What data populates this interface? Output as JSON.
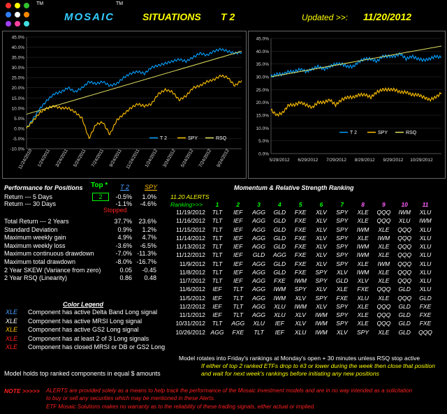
{
  "header": {
    "tm1": "TM",
    "title1": "MOSAIC",
    "tm2": "TM",
    "title2": "SITUATIONS",
    "title3": "T 2",
    "updated_label": "Updated >>:",
    "updated_date": "11/20/2012"
  },
  "colors": {
    "t2": "#00a0ff",
    "spy": "#ffc000",
    "trend": "#e0e060",
    "yellow": "#ffff00",
    "green": "#00ff00",
    "blue": "#4aa0ff",
    "red": "#ff2020",
    "orange": "#ffc000",
    "cyan_title": "#33ccff"
  },
  "chart_data": [
    {
      "type": "line",
      "ylim": [
        -0.1,
        0.45
      ],
      "yticks": [
        "45.0%",
        "40.0%",
        "35.0%",
        "30.0%",
        "25.0%",
        "20.0%",
        "15.0%",
        "10.0%",
        "5.0%",
        "0.0%",
        "-5.0%",
        "-10.0%"
      ],
      "xticks": [
        "11/24/2010",
        "1/24/2011",
        "3/24/2011",
        "5/24/2011",
        "7/24/2011",
        "9/24/2011",
        "11/24/2011",
        "1/24/2012",
        "3/24/2012",
        "5/24/2012",
        "7/24/2012",
        "9/24/2012"
      ],
      "legend": [
        "T 2",
        "SPY",
        "RSQ"
      ],
      "series": [
        {
          "name": "T 2",
          "values": [
            0.0,
            0.05,
            0.1,
            0.14,
            0.17,
            0.18,
            0.2,
            0.18,
            0.2,
            0.23,
            0.22,
            0.23,
            0.21,
            0.22,
            0.25,
            0.27,
            0.28,
            0.27,
            0.3,
            0.31,
            0.32,
            0.33,
            0.34,
            0.33,
            0.35,
            0.37,
            0.36,
            0.38,
            0.39,
            0.38,
            0.37,
            0.375
          ]
        },
        {
          "name": "SPY",
          "values": [
            0.0,
            0.04,
            0.08,
            0.1,
            0.11,
            0.1,
            0.1,
            0.08,
            0.05,
            -0.05,
            0.02,
            0.03,
            -0.03,
            0.04,
            0.07,
            0.1,
            0.12,
            0.11,
            0.12,
            0.17,
            0.19,
            0.18,
            0.14,
            0.16,
            0.2,
            0.21,
            0.23,
            0.24,
            0.26,
            0.25,
            0.21,
            0.236
          ]
        },
        {
          "name": "RSQ",
          "values": [
            0.07,
            0.38
          ]
        }
      ]
    },
    {
      "type": "line",
      "ylim": [
        0.0,
        0.45
      ],
      "yticks": [
        "45.0%",
        "40.0%",
        "35.0%",
        "30.0%",
        "25.0%",
        "20.0%",
        "15.0%",
        "10.0%",
        "5.0%",
        "0.0%"
      ],
      "xticks": [
        "5/29/2012",
        "6/29/2012",
        "7/29/2012",
        "8/29/2012",
        "9/29/2012",
        "10/29/2012"
      ],
      "legend": [
        "T 2",
        "SPY",
        "RSQ"
      ],
      "series": [
        {
          "name": "T 2",
          "values": [
            0.3,
            0.31,
            0.31,
            0.32,
            0.32,
            0.33,
            0.32,
            0.33,
            0.34,
            0.33,
            0.34,
            0.35,
            0.35,
            0.34,
            0.34,
            0.36,
            0.37,
            0.37,
            0.36,
            0.38,
            0.38,
            0.38,
            0.39,
            0.37,
            0.38,
            0.37,
            0.365,
            0.37,
            0.38,
            0.375
          ]
        },
        {
          "name": "SPY",
          "values": [
            0.17,
            0.15,
            0.16,
            0.19,
            0.19,
            0.2,
            0.19,
            0.18,
            0.2,
            0.2,
            0.21,
            0.19,
            0.21,
            0.22,
            0.22,
            0.23,
            0.23,
            0.22,
            0.24,
            0.25,
            0.25,
            0.25,
            0.24,
            0.24,
            0.23,
            0.23,
            0.22,
            0.21,
            0.22,
            0.236
          ]
        },
        {
          "name": "RSQ",
          "values": [
            0.3,
            0.42
          ]
        }
      ]
    }
  ],
  "perf": {
    "title": "Performance for Positions",
    "top_label": "Top *",
    "top_value": "2",
    "col_t2": "T 2",
    "col_spy": "SPY",
    "stopped": "Stopped",
    "rows_top": [
      {
        "label": "Return --- 5 Days",
        "t2": "-0.5%",
        "spy": "1.0%"
      },
      {
        "label": "Return --- 30 Days",
        "t2": "-1.1%",
        "spy": "-4.6%"
      }
    ],
    "rows": [
      {
        "label": "Total Return --- 2 Years",
        "t2": "37.7%",
        "spy": "23.6%"
      },
      {
        "label": "Standard Deviation",
        "t2": "0.9%",
        "spy": "1.2%"
      },
      {
        "label": "Maximum weekly gain",
        "t2": "4.9%",
        "spy": "4.7%"
      },
      {
        "label": "Maximum weekly loss",
        "t2": "-3.6%",
        "spy": "-6.5%"
      },
      {
        "label": "Maximum continuous drawdown",
        "t2": "-7.0%",
        "spy": "-11.3%"
      },
      {
        "label": "Maximum total drawdown",
        "t2": "-8.0%",
        "spy": "-16.7%"
      },
      {
        "label": "2 Year SKEW  (Variance from zero)",
        "t2": "0.05",
        "spy": "-0.45"
      },
      {
        "label": "2 Year RSQ  (Linearity)",
        "t2": "0.86",
        "spy": "0.48"
      }
    ]
  },
  "ranking": {
    "title": "Momentum & Relative Strength Ranking",
    "alerts_label": "11.20 ALERTS",
    "ranking_label": "Ranking>>>",
    "col_nums": [
      "1",
      "2",
      "3",
      "4",
      "5",
      "6",
      "7",
      "8",
      "9",
      "10",
      "11"
    ],
    "rows": [
      {
        "date": "11/19/2012",
        "items": [
          "TLT",
          "IEF",
          "AGG",
          "GLD",
          "FXE",
          "XLV",
          "SPY",
          "XLE",
          "QQQ",
          "IWM",
          "XLU"
        ]
      },
      {
        "date": "11/16/2012",
        "items": [
          "TLT",
          "IEF",
          "AGG",
          "GLD",
          "FXE",
          "XLV",
          "SPY",
          "XLE",
          "QQQ",
          "XLU",
          "IWM"
        ]
      },
      {
        "date": "11/15/2012",
        "items": [
          "TLT",
          "IEF",
          "AGG",
          "GLD",
          "FXE",
          "XLV",
          "SPY",
          "IWM",
          "XLE",
          "QQQ",
          "XLU"
        ]
      },
      {
        "date": "11/14/2012",
        "items": [
          "TLT",
          "IEF",
          "AGG",
          "GLD",
          "FXE",
          "XLV",
          "SPY",
          "XLE",
          "IWM",
          "QQQ",
          "XLU"
        ]
      },
      {
        "date": "11/13/2012",
        "items": [
          "TLT",
          "IEF",
          "AGG",
          "GLD",
          "FXE",
          "XLV",
          "SPY",
          "IWM",
          "XLE",
          "QQQ",
          "XLU"
        ]
      },
      {
        "date": "11/12/2012",
        "items": [
          "TLT",
          "IEF",
          "GLD",
          "AGG",
          "FXE",
          "XLV",
          "SPY",
          "IWM",
          "XLE",
          "QQQ",
          "XLU"
        ]
      },
      {
        "date": "11/9/2012",
        "items": [
          "TLT",
          "IEF",
          "AGG",
          "GLD",
          "FXE",
          "XLV",
          "SPY",
          "XLE",
          "IWM",
          "QQQ",
          "XLU"
        ]
      },
      {
        "date": "11/8/2012",
        "items": [
          "TLT",
          "IEF",
          "AGG",
          "GLD",
          "FXE",
          "SPY",
          "XLV",
          "IWM",
          "XLE",
          "QQQ",
          "XLU"
        ]
      },
      {
        "date": "11/7/2012",
        "items": [
          "TLT",
          "IEF",
          "AGG",
          "FXE",
          "IWM",
          "SPY",
          "GLD",
          "XLV",
          "XLE",
          "QQQ",
          "XLU"
        ]
      },
      {
        "date": "11/6/2012",
        "items": [
          "IEF",
          "TLT",
          "AGG",
          "IWM",
          "SPY",
          "XLV",
          "XLE",
          "FXE",
          "QQQ",
          "GLD",
          "XLU"
        ]
      },
      {
        "date": "11/5/2012",
        "items": [
          "IEF",
          "TLT",
          "AGG",
          "IWM",
          "XLV",
          "SPY",
          "FXE",
          "XLU",
          "XLE",
          "QQQ",
          "GLD"
        ]
      },
      {
        "date": "11/2/2012",
        "items": [
          "IEF",
          "TLT",
          "AGG",
          "XLU",
          "IWM",
          "XLV",
          "SPY",
          "XLE",
          "QQQ",
          "GLD",
          "FXE"
        ]
      },
      {
        "date": "11/1/2012",
        "items": [
          "IEF",
          "TLT",
          "AGG",
          "XLU",
          "XLV",
          "IWM",
          "SPY",
          "XLE",
          "QQQ",
          "GLD",
          "FXE"
        ]
      },
      {
        "date": "10/31/2012",
        "items": [
          "TLT",
          "AGG",
          "XLU",
          "IEF",
          "XLV",
          "IWM",
          "SPY",
          "XLE",
          "QQQ",
          "GLD",
          "FXE"
        ]
      },
      {
        "date": "10/26/2012",
        "items": [
          "AGG",
          "FXE",
          "TLT",
          "IEF",
          "XLU",
          "IWM",
          "XLV",
          "SPY",
          "XLE",
          "GLD",
          "QQQ"
        ]
      }
    ]
  },
  "legend": {
    "title": "Color Legend",
    "items": [
      {
        "sym": "XLE",
        "text": "Component has active Delta Band Long signal",
        "color": "#4aa0ff"
      },
      {
        "sym": "XLE",
        "text": "Component has active MRSI Long signal",
        "color": "#ffffff"
      },
      {
        "sym": "XLE",
        "text": "Component has active GS2 Long signal",
        "color": "#ffc000"
      },
      {
        "sym": "XLE",
        "text": "Component has at least 2 of 3 Long signals",
        "color": "#ff2020"
      },
      {
        "sym": "XLE",
        "text": "Component has closed MRSI or DB or GS2 Long",
        "color": "#ff2020"
      }
    ]
  },
  "notes": {
    "model_holds": "Model holds top ranked  components in equal  $ amounts",
    "model_rotates": "Model rotates into Friday's rankings at Monday's open + 30 minutes unless RSQ stop active",
    "stop_line1": "If either of top 2 ranked ETFs drop to #3 or lower during the week then close that position",
    "stop_line2": "and wait for next week's rankings before initiating any new positions",
    "note_label": "NOTE  >>>>>",
    "disclaimer1": "ALERTS are provided solely as a means to help track the performance of the Mosaic investment models and are in no way intended as a solicitation",
    "disclaimer2": "to buy or sell any securities which may be mentioned in these Alerts.",
    "disclaimer3": "ETF Mosaic Solutions makes no warranty as to the reliability of these trading signals, either actual or implied."
  }
}
